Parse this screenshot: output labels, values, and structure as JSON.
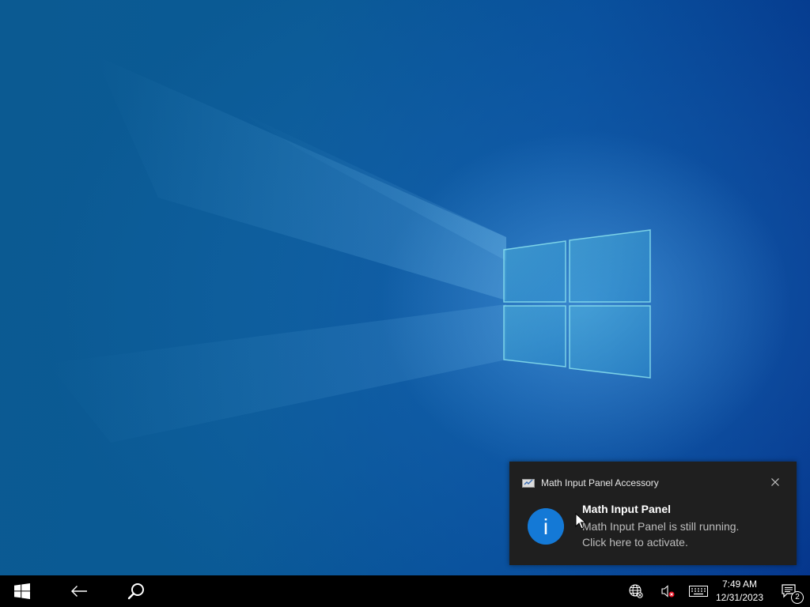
{
  "toast": {
    "app_name": "Math Input Panel Accessory",
    "title": "Math Input Panel",
    "body_line1": "Math Input Panel is still running.",
    "body_line2": "Click here to activate.",
    "info_glyph": "i",
    "app_icon": "math-input-panel-icon",
    "close_icon": "close-icon",
    "accent_color": "#1479d6"
  },
  "taskbar": {
    "start_icon": "windows-logo-icon",
    "back_icon": "back-arrow-icon",
    "search_icon": "search-icon",
    "tray": {
      "network_icon": "globe-network-icon",
      "volume_icon": "volume-muted-icon",
      "keyboard_icon": "touch-keyboard-icon"
    },
    "clock": {
      "time": "7:49 AM",
      "date": "12/31/2023"
    },
    "action_center": {
      "icon": "action-center-icon",
      "count": "2"
    }
  }
}
